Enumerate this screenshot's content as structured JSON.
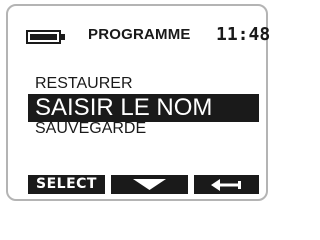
{
  "header": {
    "title": "PROGRAMME",
    "time": "11:48",
    "battery_icon": "battery-full-icon"
  },
  "menu": {
    "items": [
      {
        "label": "RESTAURER",
        "selected": false
      },
      {
        "label": "SAISIR LE NOM",
        "selected": true
      },
      {
        "label": "SAUVEGARDE",
        "selected": false
      }
    ]
  },
  "softkeys": {
    "select_label": "SELECT",
    "down_icon": "down-arrow-icon",
    "back_icon": "back-arrow-icon"
  },
  "colors": {
    "foreground": "#1a1a1a",
    "background": "#ffffff",
    "bezel": "#b4b4b4"
  }
}
